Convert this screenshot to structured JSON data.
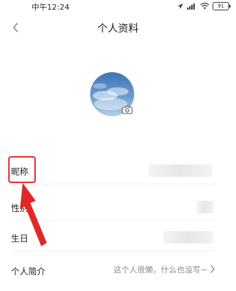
{
  "status_bar": {
    "time": "中午12:24",
    "battery": "91",
    "icons": [
      "location-icon",
      "signal-icon",
      "wifi-icon",
      "battery-icon"
    ]
  },
  "header": {
    "title": "个人资料",
    "back_icon": "chevron-left-icon"
  },
  "avatar": {
    "camera_icon": "camera-icon"
  },
  "profile_rows": [
    {
      "label": "昵称",
      "value": ""
    },
    {
      "label": "性别",
      "value": ""
    },
    {
      "label": "生日",
      "value": ""
    },
    {
      "label": "个人简介",
      "value": "这个人很懒，什么也没写~"
    }
  ],
  "annotation": {
    "color": "#e02828"
  }
}
